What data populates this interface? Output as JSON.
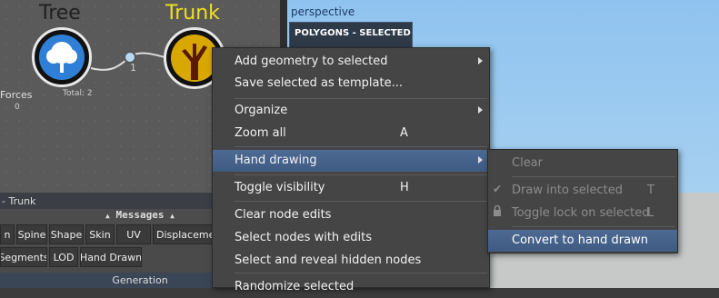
{
  "graph": {
    "tree_title": "Tree",
    "trunk_title": "Trunk",
    "link_count": "1",
    "total_label": "Total: 2",
    "forces_label": "Forces",
    "forces_count": "0"
  },
  "viewport": {
    "label": "perspective",
    "polygons_label": "POLYGONS - SELECTED"
  },
  "panel": {
    "title": "- Trunk",
    "messages_label": "Messages",
    "tabs_row1": [
      "n",
      "Spine",
      "Shape",
      "Skin",
      "UV",
      "Displacement"
    ],
    "tabs_row2": [
      "Segments",
      "LOD",
      "Hand Drawn"
    ],
    "generation_label": "Generation"
  },
  "context_menu": {
    "items": [
      {
        "label": "Add geometry to selected",
        "shortcut": "",
        "submenu": true
      },
      {
        "label": "Save selected as template...",
        "shortcut": "",
        "submenu": false
      },
      {
        "label": "Organize",
        "shortcut": "",
        "submenu": true
      },
      {
        "label": "Zoom all",
        "shortcut": "A",
        "submenu": false
      },
      {
        "label": "Hand drawing",
        "shortcut": "",
        "submenu": true
      },
      {
        "label": "Toggle visibility",
        "shortcut": "H",
        "submenu": false
      },
      {
        "label": "Clear node edits",
        "shortcut": "",
        "submenu": false
      },
      {
        "label": "Select nodes with edits",
        "shortcut": "",
        "submenu": false
      },
      {
        "label": "Select and reveal hidden nodes",
        "shortcut": "",
        "submenu": false
      },
      {
        "label": "Randomize selected",
        "shortcut": "",
        "submenu": false
      }
    ]
  },
  "submenu": {
    "items": [
      {
        "label": "Clear",
        "shortcut": "",
        "icon": ""
      },
      {
        "label": "Draw into selected",
        "shortcut": "T",
        "icon": "checkmark-icon"
      },
      {
        "label": "Toggle lock on selected",
        "shortcut": "L",
        "icon": "lock-icon"
      },
      {
        "label": "Convert to hand drawn",
        "shortcut": "",
        "icon": ""
      }
    ]
  },
  "colors": {
    "highlight": "#4d6a94",
    "trunk_title": "#f0e020",
    "menu_bg": "#454545"
  }
}
